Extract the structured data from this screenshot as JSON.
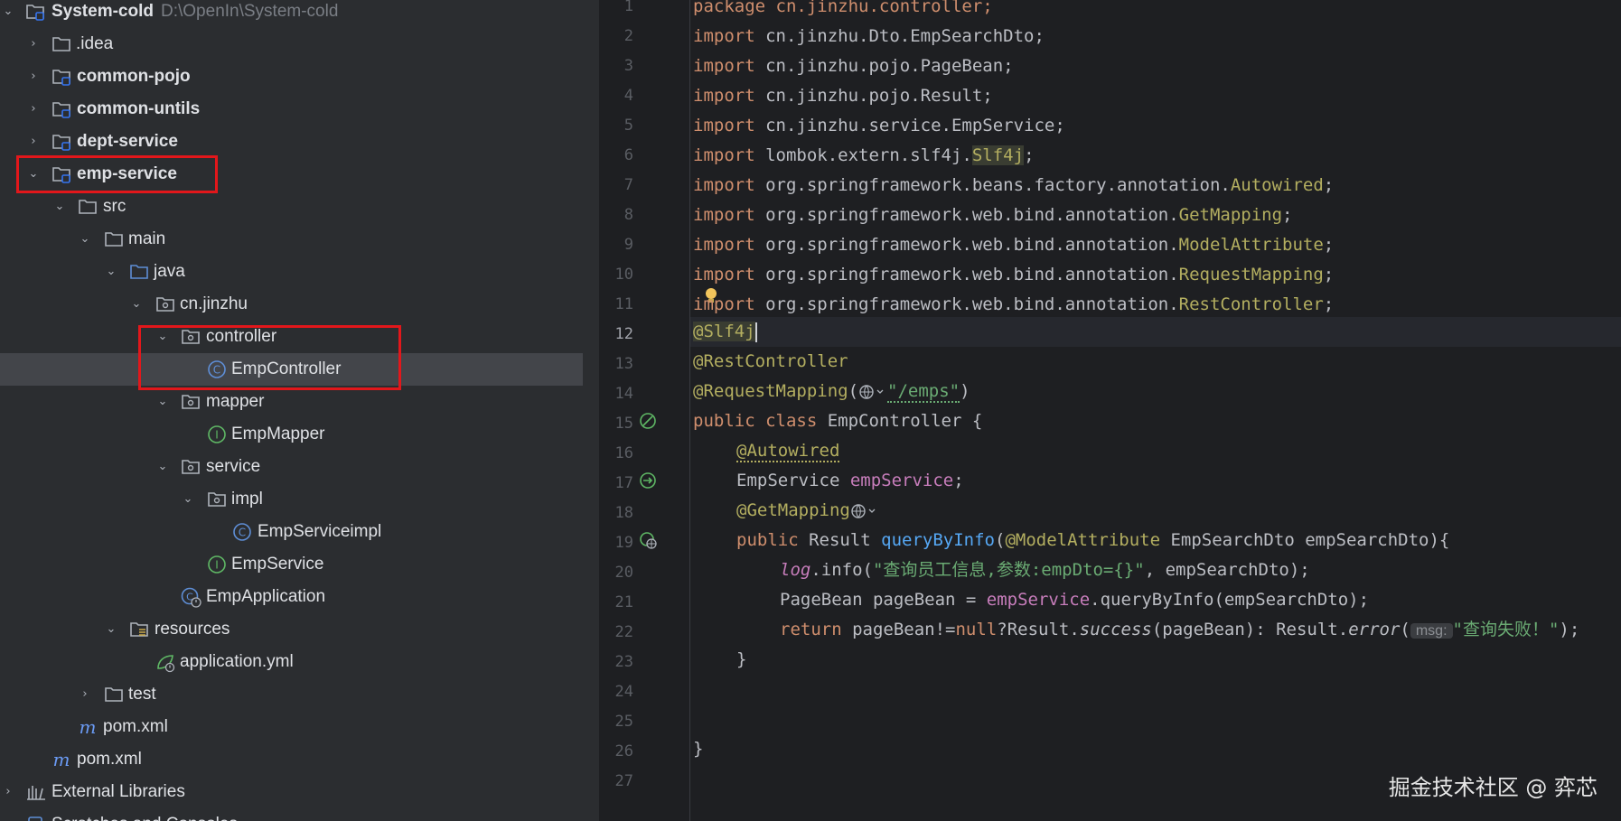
{
  "project_tree": {
    "root": {
      "name": "System-cold",
      "path": "D:\\OpenIn\\System-cold"
    },
    "items": [
      {
        "label": "System-cold"
      },
      {
        "label": ".idea"
      },
      {
        "label": "common-pojo"
      },
      {
        "label": "common-untils"
      },
      {
        "label": "dept-service"
      },
      {
        "label": "emp-service"
      },
      {
        "label": "src"
      },
      {
        "label": "main"
      },
      {
        "label": "java"
      },
      {
        "label": "cn.jinzhu"
      },
      {
        "label": "controller"
      },
      {
        "label": "EmpController"
      },
      {
        "label": "mapper"
      },
      {
        "label": "EmpMapper"
      },
      {
        "label": "service"
      },
      {
        "label": "impl"
      },
      {
        "label": "EmpServiceimpl"
      },
      {
        "label": "EmpService"
      },
      {
        "label": "EmpApplication"
      },
      {
        "label": "resources"
      },
      {
        "label": "application.yml"
      },
      {
        "label": "test"
      },
      {
        "label": "pom.xml"
      },
      {
        "label": "pom.xml"
      },
      {
        "label": "External Libraries"
      },
      {
        "label": "Scratches and Consoles"
      }
    ]
  },
  "editor": {
    "line_numbers": [
      "1",
      "2",
      "3",
      "4",
      "5",
      "6",
      "7",
      "8",
      "9",
      "10",
      "11",
      "12",
      "13",
      "14",
      "15",
      "16",
      "17",
      "18",
      "19",
      "20",
      "21",
      "22",
      "23",
      "24",
      "25",
      "26",
      "27"
    ],
    "current_line": "12",
    "code": {
      "l1": "package cn.jinzhu.controller;",
      "l2a": "import",
      "l2b": " cn.jinzhu.Dto.EmpSearchDto;",
      "l3a": "import",
      "l3b": " cn.jinzhu.pojo.PageBean;",
      "l4a": "import",
      "l4b": " cn.jinzhu.pojo.Result;",
      "l5a": "import",
      "l5b": " cn.jinzhu.service.EmpService;",
      "l6a": "import",
      "l6b": " lombok.extern.slf4j.",
      "l6c": "Slf4j",
      "l6d": ";",
      "l7a": "import",
      "l7b": " org.springframework.beans.factory.annotation.",
      "l7c": "Autowired",
      "l7d": ";",
      "l8a": "import",
      "l8b": " org.springframework.web.bind.annotation.",
      "l8c": "GetMapping",
      "l8d": ";",
      "l9a": "import",
      "l9b": " org.springframework.web.bind.annotation.",
      "l9c": "ModelAttribute",
      "l9d": ";",
      "l10a": "import",
      "l10b": " org.springframework.web.bind.annotation.",
      "l10c": "RequestMapping",
      "l10d": ";",
      "l11a": "import",
      "l11b": " org.springframework.web.bind.annotation.",
      "l11c": "RestController",
      "l11d": ";",
      "l12": "@Slf4j",
      "l13": "@RestController",
      "l14a": "@RequestMapping",
      "l14b": "(",
      "l14c": "\"/emps\"",
      "l14d": ")",
      "l15a": "public class",
      "l15b": " EmpController {",
      "l16": "@Autowired",
      "l17a": "EmpService ",
      "l17b": "empService",
      "l17c": ";",
      "l18": "@GetMapping",
      "l19a": "public",
      "l19b": " Result ",
      "l19c": "queryByInfo",
      "l19d": "(",
      "l19e": "@ModelAttribute",
      "l19f": " EmpSearchDto empSearchDto){",
      "l20a": "log",
      "l20b": ".info(",
      "l20c": "\"查询员工信息,参数:empDto={}\"",
      "l20d": ", empSearchDto);",
      "l21a": "PageBean pageBean = ",
      "l21b": "empService",
      "l21c": ".queryByInfo(empSearchDto);",
      "l22a": "return",
      "l22b": " pageBean!=",
      "l22c": "null",
      "l22d": "?Result.",
      "l22e": "success",
      "l22f": "(pageBean): Result.",
      "l22g": "error",
      "l22h": "(",
      "l22hint": "msg:",
      "l22i": "\"查询失败！\"",
      "l22j": ");",
      "l23": "}",
      "l26": "}"
    }
  },
  "watermark": "掘金技术社区 @ 弈芯",
  "colors": {
    "highlight_box": "#e2171b",
    "accent": "#3574f0",
    "keyword": "#cf8e6d",
    "annotation": "#b3ae60",
    "string": "#6aab73"
  }
}
